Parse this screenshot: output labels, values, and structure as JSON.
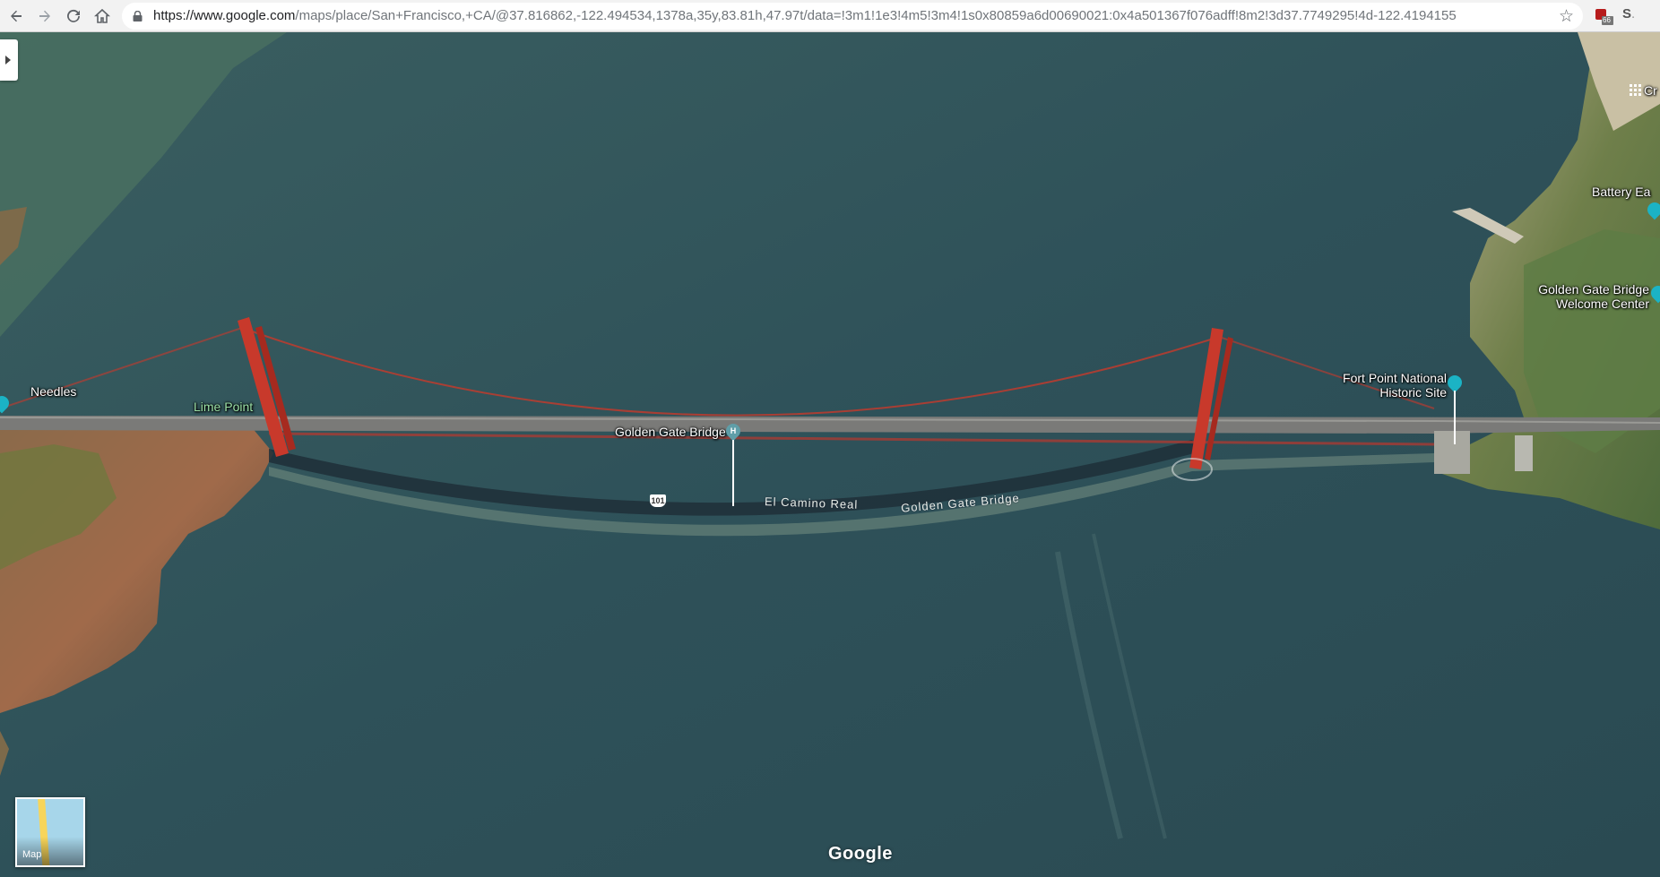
{
  "browser": {
    "url_host": "https://www.google.com",
    "url_path": "/maps/place/San+Francisco,+CA/@37.816862,-122.494534,1378a,35y,83.81h,47.97t/data=!3m1!1e3!4m5!3m4!1s0x80859a6d00690021:0x4a501367f076adff!8m2!3d37.7749295!4d-122.4194155",
    "ext_badge": "66",
    "profile_initial": "S"
  },
  "map": {
    "labels": {
      "needles": "Needles",
      "lime_point": "Lime Point",
      "golden_gate_bridge": "Golden Gate Bridge",
      "el_camino_real": "El Camino Real",
      "golden_gate_bridge_road": "Golden Gate Bridge",
      "route_shield": "101",
      "fort_point_1": "Fort Point National",
      "fort_point_2": "Historic Site",
      "welcome_center_1": "Golden Gate Bridge",
      "welcome_center_2": "Welcome Center",
      "battery": "Battery Ea",
      "cr": "Cr"
    },
    "layer_tile_label": "Map",
    "attribution": "Google"
  },
  "colors": {
    "water": "#2f5259",
    "bridge": "#c8392b",
    "land": "#6b7a3c",
    "pin_teal": "#1bb3c5"
  },
  "icons": [
    "back-icon",
    "forward-icon",
    "reload-icon",
    "home-icon",
    "lock-icon",
    "star-icon",
    "apps-icon",
    "chevron-right-icon"
  ]
}
